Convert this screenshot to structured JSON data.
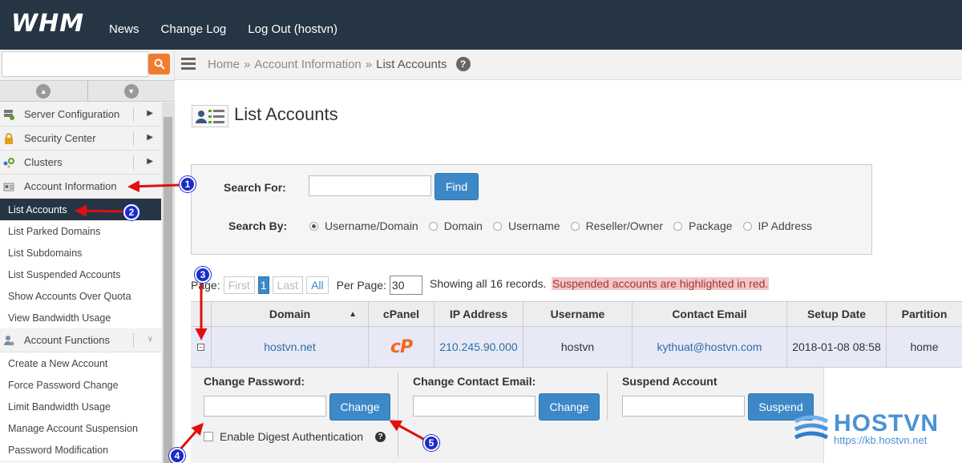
{
  "app": {
    "logo": "WHM"
  },
  "topnav": {
    "news": "News",
    "changelog": "Change Log",
    "logout": "Log Out (hostvn)"
  },
  "sidebar": {
    "search_placeholder": "",
    "categories": {
      "server_config": "Server Configuration",
      "security_center": "Security Center",
      "clusters": "Clusters",
      "account_information": "Account Information",
      "account_functions": "Account Functions"
    },
    "account_info_items": [
      "List Accounts",
      "List Parked Domains",
      "List Subdomains",
      "List Suspended Accounts",
      "Show Accounts Over Quota",
      "View Bandwidth Usage"
    ],
    "account_function_items": [
      "Create a New Account",
      "Force Password Change",
      "Limit Bandwidth Usage",
      "Manage Account Suspension",
      "Password Modification"
    ]
  },
  "breadcrumb": {
    "home": "Home",
    "sep": "»",
    "section": "Account Information",
    "current": "List Accounts",
    "help": "?"
  },
  "page": {
    "title": "List Accounts"
  },
  "search": {
    "search_for_label": "Search For:",
    "search_value": "",
    "find_label": "Find",
    "search_by_label": "Search By:",
    "options": [
      "Username/Domain",
      "Domain",
      "Username",
      "Reseller/Owner",
      "Package",
      "IP Address"
    ],
    "selected": "Username/Domain"
  },
  "pagination": {
    "page_label": "Page:",
    "first": "First",
    "current": "1",
    "last": "Last",
    "all": "All",
    "per_page_label": "Per Page:",
    "per_page": "30",
    "showing": "Showing all 16 records.",
    "suspended_note": "Suspended accounts are highlighted in red."
  },
  "table": {
    "headers": {
      "domain": "Domain",
      "cpanel": "cPanel",
      "ip": "IP Address",
      "username": "Username",
      "email": "Contact Email",
      "setup": "Setup Date",
      "partition": "Partition"
    },
    "sort_indicator": "▲",
    "row": {
      "expand": "−",
      "domain": "hostvn.net",
      "cpanel_logo": "cP",
      "ip": "210.245.90.000",
      "username": "hostvn",
      "email": "kythuat@hostvn.com",
      "setup_date": "2018-01-08 08:58",
      "partition": "home"
    }
  },
  "details": {
    "change_password_label": "Change Password:",
    "change_btn": "Change",
    "change_email_label": "Change Contact Email:",
    "change_email_btn": "Change",
    "suspend_label": "Suspend Account",
    "suspend_btn": "Suspend",
    "digest_label": "Enable Digest Authentication",
    "help": "?"
  },
  "annotations": [
    "1",
    "2",
    "3",
    "4",
    "5"
  ],
  "watermark": {
    "name": "HOSTVN",
    "url": "https://kb.hostvn.net"
  },
  "colors": {
    "topbar": "#263544",
    "accent_blue": "#3d89c7",
    "search_orange": "#f07d2e",
    "cpanel_orange": "#f26722",
    "row_bg": "#e7e9f7",
    "suspended_bg": "#f1c7c7",
    "arrow_red": "#e01010",
    "badge_blue": "#1b2cc8"
  }
}
